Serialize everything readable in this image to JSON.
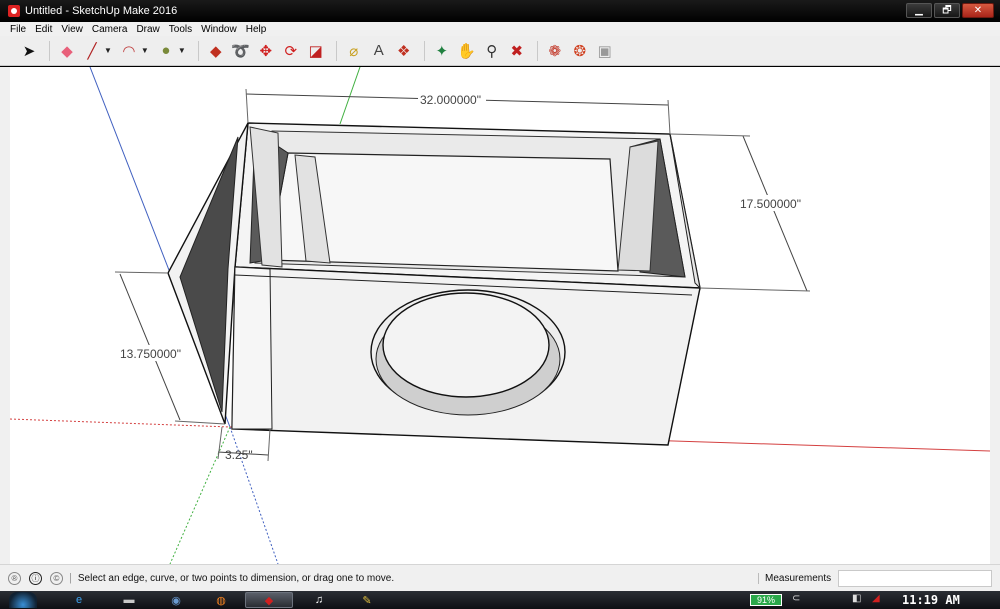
{
  "window": {
    "title": "Untitled - SketchUp Make 2016",
    "minimize_glyph": "▁",
    "maximize_glyph": "🗗",
    "close_glyph": "✕"
  },
  "menu": [
    "File",
    "Edit",
    "View",
    "Camera",
    "Draw",
    "Tools",
    "Window",
    "Help"
  ],
  "toolbar": {
    "tools": [
      {
        "name": "select-tool-icon",
        "glyph": "➤",
        "color": "#111111"
      },
      {
        "name": "eraser-tool-icon",
        "glyph": "◆",
        "color": "#e8607a"
      },
      {
        "name": "line-tool-icon",
        "glyph": "╱",
        "color": "#b02020"
      },
      {
        "name": "arc-tool-icon",
        "glyph": "◠",
        "color": "#c04040"
      },
      {
        "name": "shapes-tool-icon",
        "glyph": "●",
        "color": "#7a8a3a"
      },
      {
        "name": "push-pull-tool-icon",
        "glyph": "◆",
        "color": "#c03020"
      },
      {
        "name": "follow-me-tool-icon",
        "glyph": "➰",
        "color": "#c02020"
      },
      {
        "name": "move-tool-icon",
        "glyph": "✥",
        "color": "#d02020"
      },
      {
        "name": "rotate-tool-icon",
        "glyph": "⟳",
        "color": "#d02020"
      },
      {
        "name": "scale-tool-icon",
        "glyph": "◪",
        "color": "#c02020"
      },
      {
        "name": "tape-measure-tool-icon",
        "glyph": "⌀",
        "color": "#c8a020"
      },
      {
        "name": "text-tool-icon",
        "glyph": "A",
        "color": "#444444"
      },
      {
        "name": "paint-bucket-tool-icon",
        "glyph": "❖",
        "color": "#c03020"
      },
      {
        "name": "orbit-tool-icon",
        "glyph": "✦",
        "color": "#208040"
      },
      {
        "name": "pan-tool-icon",
        "glyph": "✋",
        "color": "#c8a020"
      },
      {
        "name": "zoom-tool-icon",
        "glyph": "⚲",
        "color": "#333333"
      },
      {
        "name": "zoom-extents-tool-icon",
        "glyph": "✖",
        "color": "#c02020"
      },
      {
        "name": "warehouse-icon",
        "glyph": "❁",
        "color": "#c03020"
      },
      {
        "name": "extension-warehouse-icon",
        "glyph": "❂",
        "color": "#d04020"
      },
      {
        "name": "share-model-icon",
        "glyph": "▣",
        "color": "#999999"
      }
    ]
  },
  "dimensions": {
    "width": "32.000000\"",
    "depth": "17.500000\"",
    "height": "13.750000\"",
    "offset": "3.25\""
  },
  "status": {
    "message": "Select an edge, curve, or two points to dimension, or drag one to move.",
    "measurements_label": "Measurements",
    "measurements_value": ""
  },
  "taskbar": {
    "battery": "91%",
    "clock": "11:19 AM",
    "apps": [
      {
        "name": "ie-taskbar-icon",
        "glyph": "e",
        "color": "#3ea3f0"
      },
      {
        "name": "explorer-taskbar-icon",
        "glyph": "▬",
        "color": "#c8c8c8"
      },
      {
        "name": "chrome-taskbar-icon",
        "glyph": "◉",
        "color": "#6a9ad0"
      },
      {
        "name": "firefox-taskbar-icon",
        "glyph": "◍",
        "color": "#f08020"
      },
      {
        "name": "sketchup-taskbar-icon",
        "glyph": "◆",
        "color": "#d02020"
      },
      {
        "name": "audio-taskbar-icon",
        "glyph": "♫",
        "color": "#ffffff"
      },
      {
        "name": "paint-taskbar-icon",
        "glyph": "✎",
        "color": "#e0c040"
      }
    ]
  },
  "colors": {
    "axis_red": "#d44040",
    "axis_green": "#40b040",
    "axis_blue": "#4060c0",
    "face_light": "#f2f2f2",
    "face_dark": "#505050"
  }
}
